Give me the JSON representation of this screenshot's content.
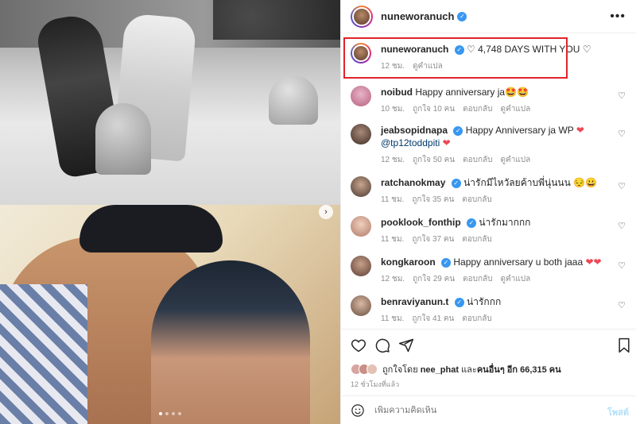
{
  "post": {
    "author": "nuneworanuch"
  },
  "caption": {
    "username": "nuneworanuch",
    "text": "♡ 4,748 DAYS WITH YOU ♡",
    "time": "12 ชม.",
    "translate": "ดูคำแปล"
  },
  "comments": [
    {
      "username": "noibud",
      "text": "Happy anniversary ja🤩🤩",
      "time": "10 ชม.",
      "likes": "ถูกใจ 10 คน",
      "reply": "ตอบกลับ",
      "translate": "ดูคำแปล",
      "verified": false
    },
    {
      "username": "jeabsopidnapa",
      "text": "Happy Anniversary ja WP",
      "mention": "@tp12toddpiti",
      "time": "12 ชม.",
      "likes": "ถูกใจ 50 คน",
      "reply": "ตอบกลับ",
      "translate": "ดูคำแปล",
      "verified": true
    },
    {
      "username": "ratchanokmay",
      "text": "น่ารักมีไหวัลยค้าบพี่นุ่นนน 😔😀",
      "time": "11 ชม.",
      "likes": "ถูกใจ 35 คน",
      "reply": "ตอบกลับ",
      "verified": true
    },
    {
      "username": "pooklook_fonthip",
      "text": "น่ารักมากกก",
      "time": "11 ชม.",
      "likes": "ถูกใจ 37 คน",
      "reply": "ตอบกลับ",
      "verified": true
    },
    {
      "username": "kongkaroon",
      "text": "Happy anniversary u both jaaa",
      "time": "12 ชม.",
      "likes": "ถูกใจ 29 คน",
      "reply": "ตอบกลับ",
      "translate": "ดูคำแปล",
      "verified": true
    },
    {
      "username": "benraviyanun.t",
      "text": "น่ารักกก",
      "time": "11 ชม.",
      "likes": "ถูกใจ 41 คน",
      "reply": "ตอบกลับ",
      "verified": true
    }
  ],
  "likes_summary": {
    "prefix": "ถูกใจโดย",
    "user": "nee_phat",
    "middle": "และ",
    "others": "คนอื่นๆ อีก 66,315 คน"
  },
  "posted_ago": "12 ชั่วโมงที่แล้ว",
  "add_comment": {
    "placeholder": "เพิ่มความคิดเห็น",
    "post_label": "โพสต์"
  },
  "colors": {
    "highlight": "#e0242b",
    "verified": "#3897f0",
    "heart_red": "#ed4956"
  }
}
